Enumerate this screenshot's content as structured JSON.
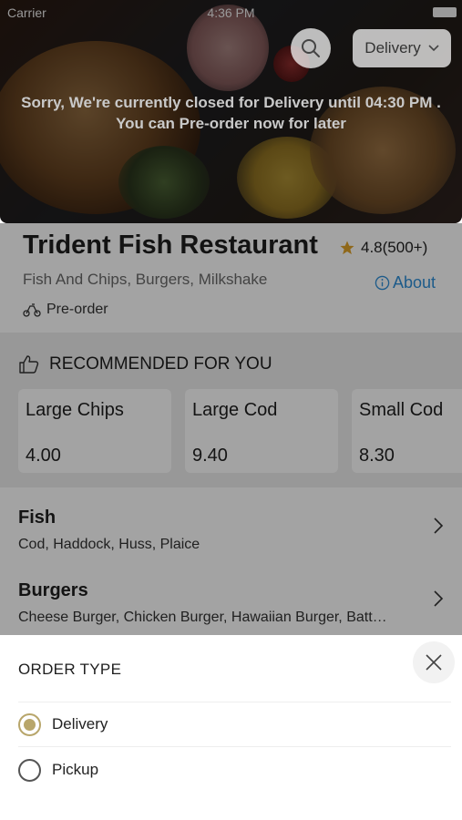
{
  "status": {
    "carrier": "Carrier",
    "time": "4:36 PM"
  },
  "header": {
    "order_type_button": "Delivery",
    "closed_message_line1": "Sorry, We're currently closed for Delivery until 04:30 PM .",
    "closed_message_line2": "You can Pre-order now for later"
  },
  "restaurant": {
    "name": "Trident Fish Restaurant",
    "rating": "4.8(500+)",
    "cuisines": "Fish And Chips, Burgers, Milkshake",
    "about_label": "About",
    "preorder_label": "Pre-order"
  },
  "recommended": {
    "heading": "RECOMMENDED FOR YOU",
    "items": [
      {
        "name": "Large Chips",
        "price": "4.00"
      },
      {
        "name": "Large Cod",
        "price": "9.40"
      },
      {
        "name": "Small Cod",
        "price": "8.30"
      }
    ]
  },
  "categories": [
    {
      "title": "Fish",
      "desc": "Cod, Haddock, Huss, Plaice"
    },
    {
      "title": "Burgers",
      "desc": "Cheese Burger, Chicken Burger, Hawaiian Burger, Batt…"
    }
  ],
  "order_sheet": {
    "title": "ORDER TYPE",
    "options": [
      {
        "label": "Delivery",
        "selected": true
      },
      {
        "label": "Pickup",
        "selected": false
      }
    ]
  },
  "colors": {
    "accent": "#b8a66b",
    "link": "#2e8fd8",
    "star": "#e0a32a"
  }
}
